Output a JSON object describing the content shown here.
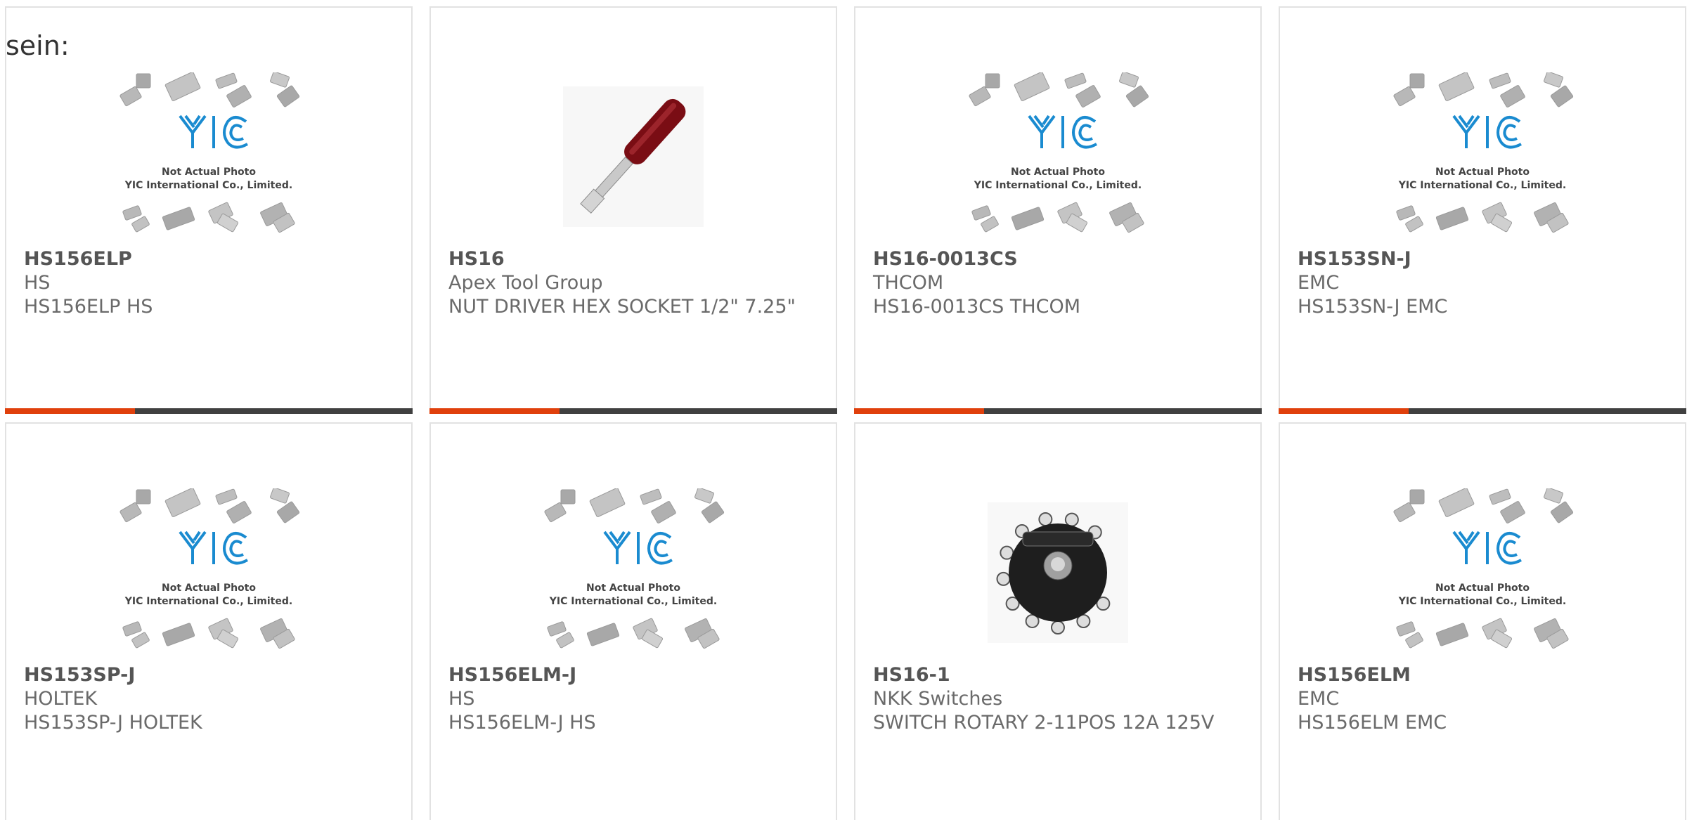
{
  "intro_text": "sein:",
  "placeholder": {
    "logo_text": "YIC",
    "line1": "Not Actual Photo",
    "line2": "YIC International Co., Limited."
  },
  "colors": {
    "accent": "#e0400c",
    "bar": "#404040",
    "logo_blue": "#1a8bd0"
  },
  "products": [
    {
      "part": "HS156ELP",
      "manufacturer": "HS",
      "description": "HS156ELP HS",
      "image": "placeholder-icon"
    },
    {
      "part": "HS16",
      "manufacturer": "Apex Tool Group",
      "description": "NUT DRIVER HEX SOCKET 1/2\" 7.25\"",
      "image": "nut-driver-icon"
    },
    {
      "part": "HS16-0013CS",
      "manufacturer": "THCOM",
      "description": "HS16-0013CS THCOM",
      "image": "placeholder-icon"
    },
    {
      "part": "HS153SN-J",
      "manufacturer": "EMC",
      "description": "HS153SN-J EMC",
      "image": "placeholder-icon"
    },
    {
      "part": "HS153SP-J",
      "manufacturer": "HOLTEK",
      "description": "HS153SP-J HOLTEK",
      "image": "placeholder-icon"
    },
    {
      "part": "HS156ELM-J",
      "manufacturer": "HS",
      "description": "HS156ELM-J HS",
      "image": "placeholder-icon"
    },
    {
      "part": "HS16-1",
      "manufacturer": "NKK Switches",
      "description": "SWITCH ROTARY 2-11POS 12A 125V",
      "image": "rotary-switch-icon"
    },
    {
      "part": "HS156ELM",
      "manufacturer": "EMC",
      "description": "HS156ELM EMC",
      "image": "placeholder-icon"
    }
  ]
}
